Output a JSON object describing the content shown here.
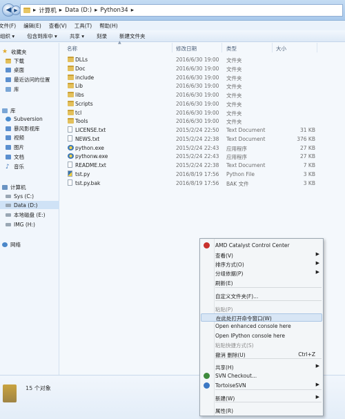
{
  "address": {
    "back_glyph": "◀",
    "forward_glyph": "▶",
    "separator_glyph": "▸",
    "crumbs": [
      "计算机",
      "Data (D:)",
      "Python34"
    ]
  },
  "menubar": {
    "items": [
      "文件(F)",
      "编辑(E)",
      "查看(V)",
      "工具(T)",
      "帮助(H)"
    ]
  },
  "toolbar": {
    "organize": "组织 ▾",
    "include_in_library": "包含到库中 ▾",
    "share": "共享 ▾",
    "burn": "刻录",
    "new_folder": "新建文件夹"
  },
  "nav_pane": {
    "favorites_header": "收藏夹",
    "favorites": [
      "下载",
      "桌面",
      "最近访问的位置",
      "库"
    ],
    "libraries_header": "库",
    "libraries": [
      "Subversion",
      "暴风影视库",
      "视频",
      "图片",
      "文档",
      "音乐"
    ],
    "computer_header": "计算机",
    "drives": [
      "Sys (C:)",
      "Data (D:)",
      "本地磁盘 (E:)",
      "IMG (H:)"
    ],
    "network_header": "网络"
  },
  "columns": {
    "name": "名称",
    "date": "修改日期",
    "type": "类型",
    "size": "大小"
  },
  "files": [
    {
      "icon": "folder",
      "name": "DLLs",
      "date": "2016/6/30 19:00",
      "type": "文件夹",
      "size": ""
    },
    {
      "icon": "folder",
      "name": "Doc",
      "date": "2016/6/30 19:00",
      "type": "文件夹",
      "size": ""
    },
    {
      "icon": "folder",
      "name": "include",
      "date": "2016/6/30 19:00",
      "type": "文件夹",
      "size": ""
    },
    {
      "icon": "folder",
      "name": "Lib",
      "date": "2016/6/30 19:00",
      "type": "文件夹",
      "size": ""
    },
    {
      "icon": "folder",
      "name": "libs",
      "date": "2016/6/30 19:00",
      "type": "文件夹",
      "size": ""
    },
    {
      "icon": "folder",
      "name": "Scripts",
      "date": "2016/6/30 19:00",
      "type": "文件夹",
      "size": ""
    },
    {
      "icon": "folder",
      "name": "tcl",
      "date": "2016/6/30 19:00",
      "type": "文件夹",
      "size": ""
    },
    {
      "icon": "folder",
      "name": "Tools",
      "date": "2016/6/30 19:00",
      "type": "文件夹",
      "size": ""
    },
    {
      "icon": "txt",
      "name": "LICENSE.txt",
      "date": "2015/2/24 22:50",
      "type": "Text Document",
      "size": "31 KB"
    },
    {
      "icon": "txt",
      "name": "NEWS.txt",
      "date": "2015/2/24 22:38",
      "type": "Text Document",
      "size": "376 KB"
    },
    {
      "icon": "exe",
      "name": "python.exe",
      "date": "2015/2/24 22:43",
      "type": "应用程序",
      "size": "27 KB"
    },
    {
      "icon": "exe",
      "name": "pythonw.exe",
      "date": "2015/2/24 22:43",
      "type": "应用程序",
      "size": "27 KB"
    },
    {
      "icon": "txt",
      "name": "README.txt",
      "date": "2015/2/24 22:38",
      "type": "Text Document",
      "size": "7 KB"
    },
    {
      "icon": "py",
      "name": "tst.py",
      "date": "2016/8/19 17:56",
      "type": "Python File",
      "size": "3 KB"
    },
    {
      "icon": "bak",
      "name": "tst.py.bak",
      "date": "2016/8/19 17:56",
      "type": "BAK 文件",
      "size": "3 KB"
    }
  ],
  "status": {
    "count_text": "15 个对象"
  },
  "context_menu": {
    "arrow_glyph": "▶",
    "items": [
      {
        "label": "AMD Catalyst Control Center",
        "icon": "amd",
        "disabled": false,
        "submenu": false,
        "shortcut": ""
      },
      {
        "label": "查看(V)",
        "disabled": false,
        "submenu": true,
        "shortcut": ""
      },
      {
        "label": "排序方式(O)",
        "disabled": false,
        "submenu": true,
        "shortcut": ""
      },
      {
        "label": "分组依据(P)",
        "disabled": false,
        "submenu": true,
        "shortcut": ""
      },
      {
        "label": "刷新(E)",
        "disabled": false,
        "submenu": false,
        "shortcut": ""
      },
      {
        "label": "自定义文件夹(F)...",
        "disabled": false,
        "submenu": false,
        "shortcut": ""
      },
      {
        "label": "粘贴(P)",
        "disabled": true,
        "submenu": false,
        "shortcut": ""
      },
      {
        "label": "在此处打开命令窗口(W)",
        "disabled": false,
        "submenu": false,
        "shortcut": "",
        "highlighted": true
      },
      {
        "label": "Open enhanced console here",
        "disabled": false,
        "submenu": false,
        "shortcut": ""
      },
      {
        "label": "Open IPython console here",
        "disabled": false,
        "submenu": false,
        "shortcut": ""
      },
      {
        "label": "粘贴快捷方式(S)",
        "disabled": true,
        "submenu": false,
        "shortcut": ""
      },
      {
        "label": "撤消 删除(U)",
        "disabled": false,
        "submenu": false,
        "shortcut": "Ctrl+Z"
      },
      {
        "label": "共享(H)",
        "disabled": false,
        "submenu": true,
        "shortcut": ""
      },
      {
        "label": "SVN Checkout...",
        "icon": "svn",
        "disabled": false,
        "submenu": false,
        "shortcut": ""
      },
      {
        "label": "TortoiseSVN",
        "icon": "tortoise",
        "disabled": false,
        "submenu": true,
        "shortcut": ""
      },
      {
        "label": "新建(W)",
        "disabled": false,
        "submenu": true,
        "shortcut": ""
      },
      {
        "label": "属性(R)",
        "disabled": false,
        "submenu": false,
        "shortcut": ""
      }
    ],
    "colors": {
      "amd": "#c8312c",
      "svn": "#3d8a3c",
      "tortoise": "#3b78c4"
    }
  }
}
